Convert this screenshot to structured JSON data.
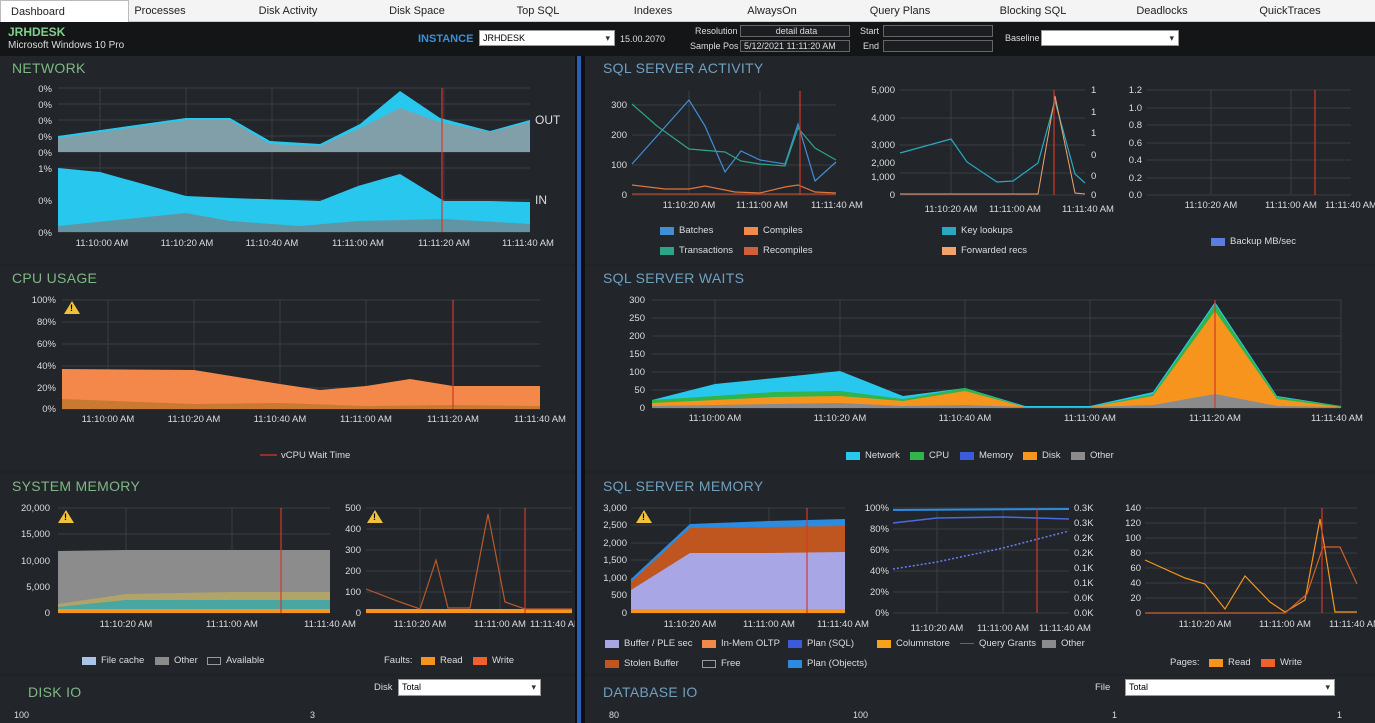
{
  "tabs": [
    "Dashboard",
    "Processes",
    "Disk Activity",
    "Disk Space",
    "Top SQL",
    "Indexes",
    "AlwaysOn",
    "Query Plans",
    "Blocking SQL",
    "Deadlocks",
    "QuickTraces"
  ],
  "header": {
    "hostname": "JRHDESK",
    "os": "Microsoft Windows 10 Pro",
    "instance_label": "INSTANCE",
    "instance_value": "JRHDESK",
    "version": "15.00.2070",
    "resolution_label": "Resolution",
    "resolution_value": "detail data",
    "sample_pos_label": "Sample Pos",
    "sample_pos_value": "5/12/2021 11:11:20 AM",
    "start_label": "Start",
    "end_label": "End",
    "baseline_label": "Baseline"
  },
  "time_ticks": [
    "11:10:00 AM",
    "11:10:20 AM",
    "11:10:40 AM",
    "11:11:00 AM",
    "11:11:20 AM",
    "11:11:40 AM"
  ],
  "time_ticks3": [
    "11:10:20 AM",
    "11:11:00 AM",
    "11:11:40 AM"
  ],
  "network": {
    "title": "NETWORK",
    "out_label": "OUT",
    "in_label": "IN",
    "out_ticks": [
      "0%",
      "0%",
      "0%",
      "0%",
      "0%"
    ],
    "in_ticks": [
      "1%",
      "0%",
      "0%"
    ]
  },
  "cpu": {
    "title": "CPU USAGE",
    "ticks": [
      "100%",
      "80%",
      "60%",
      "40%",
      "20%",
      "0%"
    ],
    "legend": "vCPU Wait Time"
  },
  "sysmem": {
    "title": "SYSTEM MEMORY",
    "ticks": [
      "20,000",
      "15,000",
      "10,000",
      "5,000",
      "0"
    ],
    "ticks2": [
      "500",
      "400",
      "300",
      "200",
      "100",
      "0"
    ],
    "legend": [
      "File cache",
      "Other",
      "Available"
    ],
    "faults_label": "Faults:",
    "faults_legend": [
      "Read",
      "Write"
    ]
  },
  "diskio": {
    "title": "DISK IO",
    "disk_label": "Disk",
    "disk_value": "Total",
    "tick1": "100",
    "tick2": "3"
  },
  "activity": {
    "title": "SQL SERVER ACTIVITY",
    "t1": [
      "300",
      "200",
      "100",
      "0"
    ],
    "t2": [
      "5,000",
      "4,000",
      "3,000",
      "2,000",
      "1,000",
      "0"
    ],
    "t2r": [
      "1",
      "1",
      "1",
      "0",
      "0",
      "0"
    ],
    "t3": [
      "1.2",
      "1.0",
      "0.8",
      "0.6",
      "0.4",
      "0.2",
      "0.0"
    ],
    "legend1": [
      "Batches",
      "Compiles",
      "Transactions",
      "Recompiles"
    ],
    "legend2": [
      "Key lookups",
      "Forwarded recs"
    ],
    "legend3": [
      "Backup MB/sec"
    ]
  },
  "waits": {
    "title": "SQL SERVER WAITS",
    "ticks": [
      "300",
      "250",
      "200",
      "150",
      "100",
      "50",
      "0"
    ],
    "legend": [
      "Network",
      "CPU",
      "Memory",
      "Disk",
      "Other"
    ]
  },
  "sqlmem": {
    "title": "SQL SERVER MEMORY",
    "t1": [
      "3,000",
      "2,500",
      "2,000",
      "1,500",
      "1,000",
      "500",
      "0"
    ],
    "t2": [
      "100%",
      "80%",
      "60%",
      "40%",
      "20%",
      "0%"
    ],
    "t2r": [
      "0.3K",
      "0.3K",
      "0.2K",
      "0.2K",
      "0.1K",
      "0.1K",
      "0.0K",
      "0.0K"
    ],
    "t3": [
      "140",
      "120",
      "100",
      "80",
      "60",
      "40",
      "20",
      "0"
    ],
    "legend": [
      "Buffer / PLE sec",
      "In-Mem OLTP",
      "Plan (SQL)",
      "Columnstore",
      "Query Grants",
      "Other",
      "Stolen Buffer",
      "Free",
      "Plan (Objects)"
    ],
    "pages_label": "Pages:",
    "pages_legend": [
      "Read",
      "Write"
    ]
  },
  "dbio": {
    "title": "DATABASE IO",
    "file_label": "File",
    "file_value": "Total",
    "tick1": "80",
    "tick2": "100",
    "tick3": "1",
    "tick4": "1"
  },
  "colors": {
    "cyan": "#28c8ee",
    "orange": "#f7941d",
    "green": "#2fb54a",
    "blue": "#3b5bdb",
    "grey": "#8b8b8b",
    "red": "#e04a2a",
    "panel": "#22252a",
    "title_blue": "#6fa0c0"
  },
  "chart_data": [
    {
      "type": "area",
      "title": "NETWORK",
      "ylabel": "",
      "series": [
        {
          "name": "OUT",
          "values": [
            0.2,
            0.25,
            0.35,
            0.35,
            0.15,
            0.1,
            0.35,
            0.7,
            0.3,
            0.25,
            0.4
          ]
        },
        {
          "name": "IN",
          "values": [
            0.9,
            0.8,
            0.55,
            0.55,
            0.5,
            0.5,
            0.7,
            0.9,
            0.45,
            0.45,
            0.45
          ]
        }
      ]
    },
    {
      "type": "area",
      "title": "CPU USAGE",
      "ylim": [
        0,
        100
      ],
      "series": [
        {
          "name": "vCPU Wait Time",
          "values": [
            35,
            35,
            34,
            34,
            26,
            17,
            18,
            25,
            19,
            19
          ]
        }
      ]
    },
    {
      "type": "area",
      "title": "SQL SERVER WAITS",
      "ylim": [
        0,
        300
      ],
      "series": [
        {
          "name": "Network",
          "values": [
            20,
            60,
            100,
            25,
            50,
            5,
            5,
            45,
            290,
            30,
            10
          ]
        },
        {
          "name": "Disk",
          "values": [
            15,
            30,
            40,
            20,
            45,
            3,
            3,
            30,
            270,
            20,
            5
          ]
        }
      ]
    }
  ]
}
